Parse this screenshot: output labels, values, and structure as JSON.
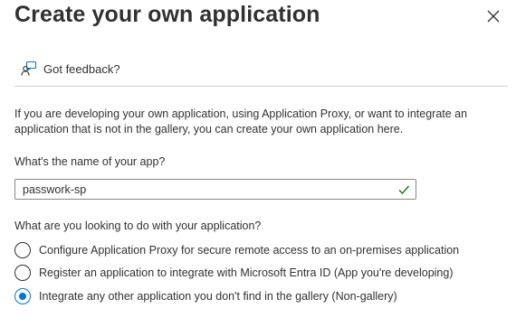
{
  "panel": {
    "title": "Create your own application",
    "close_icon": "close-icon"
  },
  "feedback": {
    "icon": "feedback-icon",
    "label": "Got feedback?"
  },
  "intro_text": "If you are developing your own application, using Application Proxy, or want to integrate an application that is not in the gallery, you can create your own application here.",
  "app_name": {
    "label": "What's the name of your app?",
    "value": "passwork-sp",
    "valid": true
  },
  "purpose": {
    "question": "What are you looking to do with your application?",
    "options": [
      {
        "label": "Configure Application Proxy for secure remote access to an on-premises application",
        "selected": false
      },
      {
        "label": "Register an application to integrate with Microsoft Entra ID (App you're developing)",
        "selected": false
      },
      {
        "label": "Integrate any other application you don't find in the gallery (Non-gallery)",
        "selected": true
      }
    ]
  },
  "colors": {
    "accent": "#0078d4",
    "valid_check": "#107c10",
    "text": "#323130",
    "divider": "#d2d0ce"
  }
}
